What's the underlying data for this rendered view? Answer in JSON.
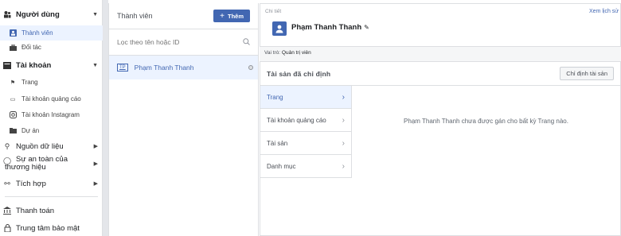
{
  "sidebar": {
    "people_header": "Người dùng",
    "members": "Thành viên",
    "partners": "Đối tác",
    "accounts_header": "Tài khoản",
    "pages": "Trang",
    "ad_accounts": "Tài khoản quảng cáo",
    "instagram_accounts": "Tài khoản Instagram",
    "projects": "Dự án",
    "data_sources": "Nguồn dữ liệu",
    "brand_safety": "Sự an toàn của thương hiệu",
    "integrations": "Tích hợp",
    "payments": "Thanh toán",
    "security_center": "Trung tâm bảo mật"
  },
  "members_panel": {
    "title": "Thành viên",
    "add_label": "Thêm",
    "search_placeholder": "Lọc theo tên hoặc ID",
    "member": {
      "initials": "TP",
      "name": "Phạm Thanh Thanh"
    }
  },
  "detail": {
    "label": "Chi tiết",
    "view_history": "Xem lịch sử",
    "name": "Phạm Thanh Thanh",
    "role_label": "Vai trò:",
    "role_value": "Quản trị viên",
    "assets_title": "Tài sản đã chỉ định",
    "assign_button": "Chỉ định tài sản",
    "categories": [
      "Trang",
      "Tài khoản quảng cáo",
      "Tài sản",
      "Danh mục"
    ],
    "empty_message": "Phạm Thanh Thanh chưa được gán cho bất kỳ Trang nào."
  },
  "colors": {
    "accent": "#4267b2",
    "active_bg": "#ecf3ff"
  }
}
